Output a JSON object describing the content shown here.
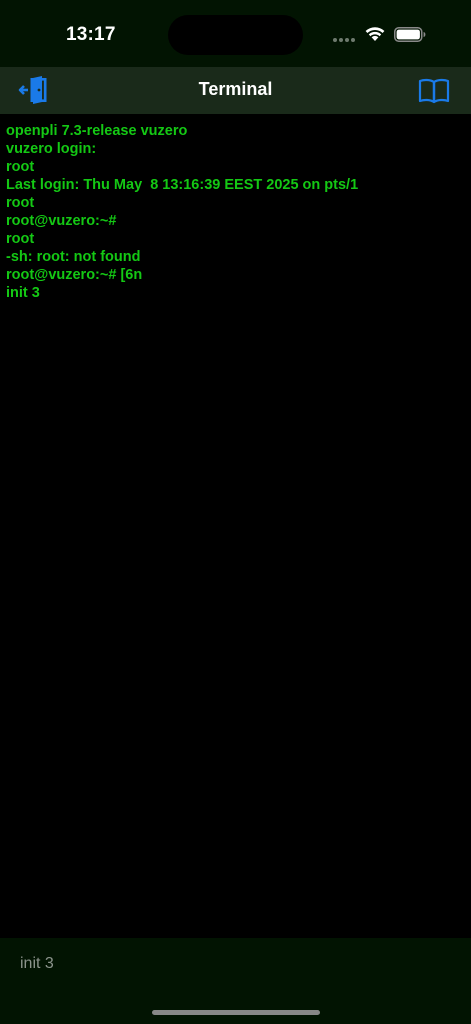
{
  "status_bar": {
    "time": "13:17",
    "wifi_icon": "wifi-icon",
    "battery_icon": "battery-icon"
  },
  "nav": {
    "title": "Terminal",
    "left_icon": "exit-door-icon",
    "right_icon": "book-icon",
    "accent_color": "#1a7ae8"
  },
  "terminal": {
    "text_color": "#14c814",
    "lines": [
      "openpli 7.3-release vuzero",
      "vuzero login:",
      "root",
      "Last login: Thu May  8 13:16:39 EEST 2025 on pts/1",
      "root",
      "root@vuzero:~#",
      "root",
      "-sh: root: not found",
      "root@vuzero:~# [6n",
      "init 3"
    ]
  },
  "input": {
    "value": "init 3"
  }
}
